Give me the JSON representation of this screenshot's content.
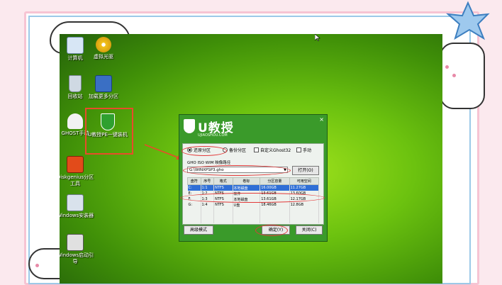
{
  "desktop_icons": [
    {
      "label": "计算机",
      "icon": "computer-icon",
      "color": "#d7e6f5"
    },
    {
      "label": "虚拟光驱",
      "icon": "disc-icon",
      "color": "#f2c21a"
    },
    {
      "label": "回收站",
      "icon": "recycle-bin-icon",
      "color": "#cfd9e3"
    },
    {
      "label": "加载更多分区",
      "icon": "partition-icon",
      "color": "#3a6fc4"
    },
    {
      "label": "GHOST手动",
      "icon": "ghost-icon",
      "color": "#f2f2f2"
    },
    {
      "label": "U教授PE一键装机",
      "icon": "shield-icon",
      "color": "#2fa02f"
    },
    {
      "label": "Diskgenius分区工具",
      "icon": "diskgenius-icon",
      "color": "#e24b1a"
    },
    {
      "label": "Windows安装器",
      "icon": "windows-installer-icon",
      "color": "#d9e2ec"
    },
    {
      "label": "Windows启动引导",
      "icon": "windows-boot-icon",
      "color": "#e0e0e0"
    }
  ],
  "window": {
    "brand": "U教授",
    "url": "UJIAOSHOU.COM",
    "close": "×",
    "radio_restore": "还原分区",
    "radio_backup": "备份分区",
    "check_custom": "自定义Ghost32",
    "check_manual": "手动",
    "path_label": "GHO ISO WIM 映像路径",
    "path_value": "G:\\WINXPSP3.gho",
    "open_button": "打开(O)",
    "columns": [
      "盘符",
      "序号",
      "格式",
      "卷标",
      "分区容量",
      "可用空间"
    ],
    "rows": [
      [
        "C:",
        "1:1",
        "NTFS",
        "本地磁盘",
        "16.00GB",
        "11.27GB"
      ],
      [
        "E:",
        "1:2",
        "NTFS",
        "软件",
        "13.61GB",
        "13.60GB"
      ],
      [
        "F:",
        "1:3",
        "NTFS",
        "本地磁盘",
        "13.61GB",
        "12.17GB"
      ],
      [
        "G:",
        "1:4",
        "NTFS",
        "U盘",
        "18.46GB",
        "12.8GB"
      ]
    ],
    "advanced_button": "高级模式",
    "ok_button": "确定(Y)",
    "cancel_button": "关闭(C)"
  }
}
